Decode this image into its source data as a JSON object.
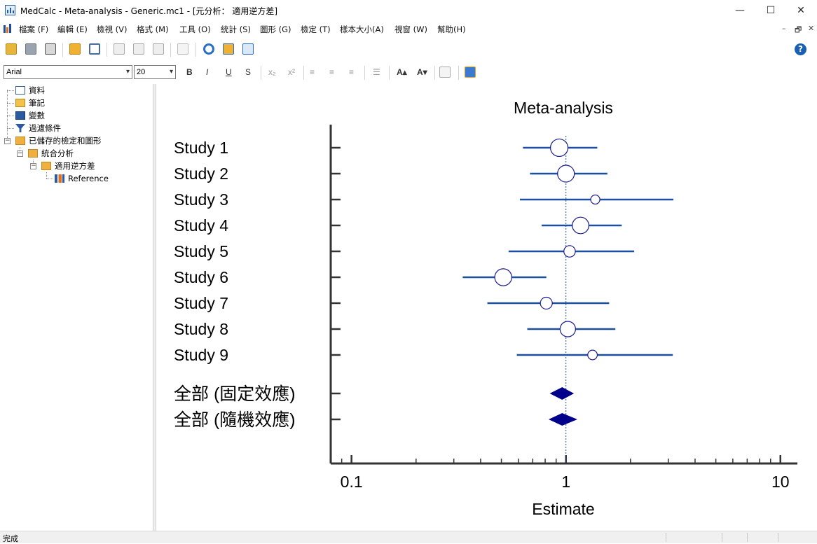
{
  "window": {
    "title": "MedCalc - Meta-analysis - Generic.mc1 - [元分析： 適用逆方差]",
    "controls": {
      "minimize": "—",
      "maximize": "☐",
      "close": "✕"
    }
  },
  "menu": {
    "items": [
      "檔案 (F)",
      "編輯 (E)",
      "檢視 (V)",
      "格式 (M)",
      "工具 (O)",
      "統計 (S)",
      "圖形 (G)",
      "檢定 (T)",
      "樣本大小(A)",
      "視窗 (W)",
      "幫助(H)"
    ],
    "mdi_controls": {
      "minimize": "–",
      "restore": "🗗",
      "close": "✕"
    }
  },
  "toolbar": {
    "icons": [
      "open-icon",
      "save-icon",
      "print-icon",
      "copy-sheet-icon",
      "table-icon",
      "cut-icon",
      "copy-icon",
      "paste-icon",
      "undo-icon",
      "refresh-icon",
      "duplicate-icon",
      "export-icon"
    ],
    "help": "?"
  },
  "format_bar": {
    "font": "Arial",
    "size": "20",
    "buttons": [
      "B",
      "I",
      "U",
      "S",
      "x₂",
      "x²",
      "≡",
      "≡",
      "≡",
      "☰",
      "A▴",
      "A▾"
    ]
  },
  "tree": {
    "items": [
      {
        "label": "資料",
        "icon": "data-grid-icon"
      },
      {
        "label": "筆記",
        "icon": "notes-icon"
      },
      {
        "label": "變數",
        "icon": "variables-icon"
      },
      {
        "label": "過濾條件",
        "icon": "filter-icon"
      },
      {
        "label": "已儲存的檢定和圖形",
        "icon": "folder-icon"
      },
      {
        "label": "統合分析",
        "icon": "folder-icon"
      },
      {
        "label": "適用逆方差",
        "icon": "folder-icon"
      },
      {
        "label": "Reference",
        "icon": "chart-icon"
      }
    ]
  },
  "chart_data": {
    "type": "forest",
    "title": "Meta-analysis",
    "xlabel": "Estimate",
    "xscale": "log",
    "xlim": [
      0.08,
      12
    ],
    "xticks": [
      0.1,
      1,
      10
    ],
    "xtick_labels": [
      "0.1",
      "1",
      "10"
    ],
    "reference_line": 1,
    "studies": [
      {
        "label": "Study 1",
        "estimate": 0.93,
        "lower": 0.63,
        "upper": 1.4,
        "weight": 0.86
      },
      {
        "label": "Study 2",
        "estimate": 1.0,
        "lower": 0.68,
        "upper": 1.56,
        "weight": 0.82
      },
      {
        "label": "Study 3",
        "estimate": 1.37,
        "lower": 0.61,
        "upper": 3.17,
        "weight": 0.32
      },
      {
        "label": "Study 4",
        "estimate": 1.17,
        "lower": 0.77,
        "upper": 1.82,
        "weight": 0.8
      },
      {
        "label": "Study 5",
        "estimate": 1.04,
        "lower": 0.54,
        "upper": 2.08,
        "weight": 0.47
      },
      {
        "label": "Study 6",
        "estimate": 0.51,
        "lower": 0.33,
        "upper": 0.81,
        "weight": 0.83
      },
      {
        "label": "Study 7",
        "estimate": 0.81,
        "lower": 0.43,
        "upper": 1.59,
        "weight": 0.5
      },
      {
        "label": "Study 8",
        "estimate": 1.02,
        "lower": 0.66,
        "upper": 1.7,
        "weight": 0.73
      },
      {
        "label": "Study 9",
        "estimate": 1.33,
        "lower": 0.59,
        "upper": 3.15,
        "weight": 0.35
      }
    ],
    "pooled": [
      {
        "label": "全部 (固定效應)",
        "estimate": 0.96,
        "lower": 0.84,
        "upper": 1.09
      },
      {
        "label": "全部 (隨機效應)",
        "estimate": 0.96,
        "lower": 0.83,
        "upper": 1.13
      }
    ],
    "colors": {
      "ci": "#1c4f9c",
      "marker_border": "#1c1c8c",
      "diamond": "#00008b",
      "axis": "#333333"
    }
  },
  "status": {
    "text": "完成"
  }
}
